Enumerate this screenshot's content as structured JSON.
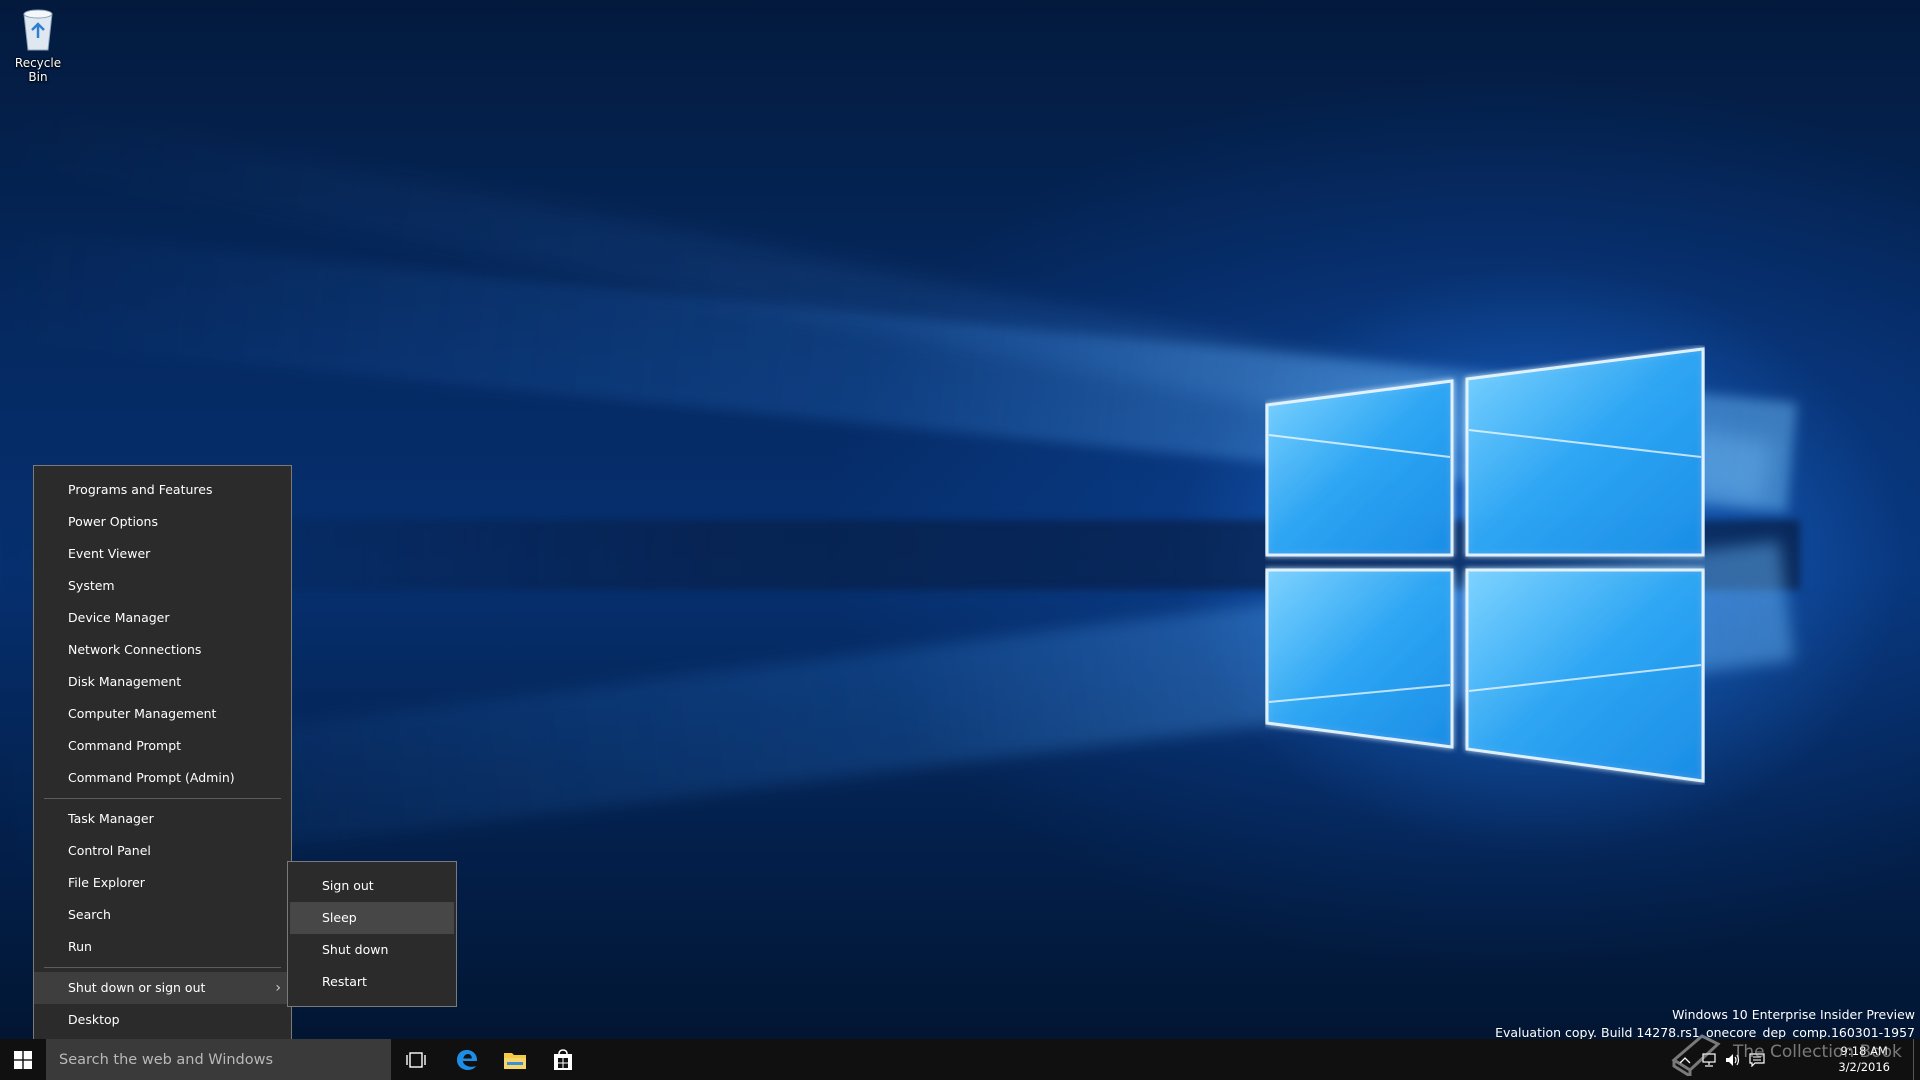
{
  "desktop": {
    "icons": [
      {
        "label": "Recycle Bin",
        "icon": "recycle-bin-icon"
      }
    ]
  },
  "watermark": {
    "line1": "Windows 10 Enterprise Insider Preview",
    "line2": "Evaluation copy. Build 14278.rs1_onecore_dep_comp.160301-1957"
  },
  "winx_menu": {
    "group1": [
      "Programs and Features",
      "Power Options",
      "Event Viewer",
      "System",
      "Device Manager",
      "Network Connections",
      "Disk Management",
      "Computer Management",
      "Command Prompt",
      "Command Prompt (Admin)"
    ],
    "group2": [
      "Task Manager",
      "Control Panel",
      "File Explorer",
      "Search",
      "Run"
    ],
    "shutdown_item": "Shut down or sign out",
    "desktop_item": "Desktop",
    "submenu_chevron": "›"
  },
  "submenu": {
    "items": [
      "Sign out",
      "Sleep",
      "Shut down",
      "Restart"
    ],
    "highlighted": "Sleep"
  },
  "taskbar": {
    "search_placeholder": "Search the web and Windows",
    "pinned": [
      {
        "name": "task-view",
        "icon": "task-view-icon"
      },
      {
        "name": "edge",
        "icon": "edge-icon"
      },
      {
        "name": "file-explorer",
        "icon": "folder-icon"
      },
      {
        "name": "store",
        "icon": "store-icon"
      }
    ],
    "clock": {
      "time": "9:18 AM",
      "date": "3/2/2016"
    },
    "overlay_watermark": "The Collection Book"
  },
  "colors": {
    "menu_bg": "#2b2b2b",
    "menu_border": "#7a7a7a",
    "taskbar_bg": "#101010",
    "search_bg": "#3a3a3a",
    "accent_blue": "#1e90ff"
  }
}
